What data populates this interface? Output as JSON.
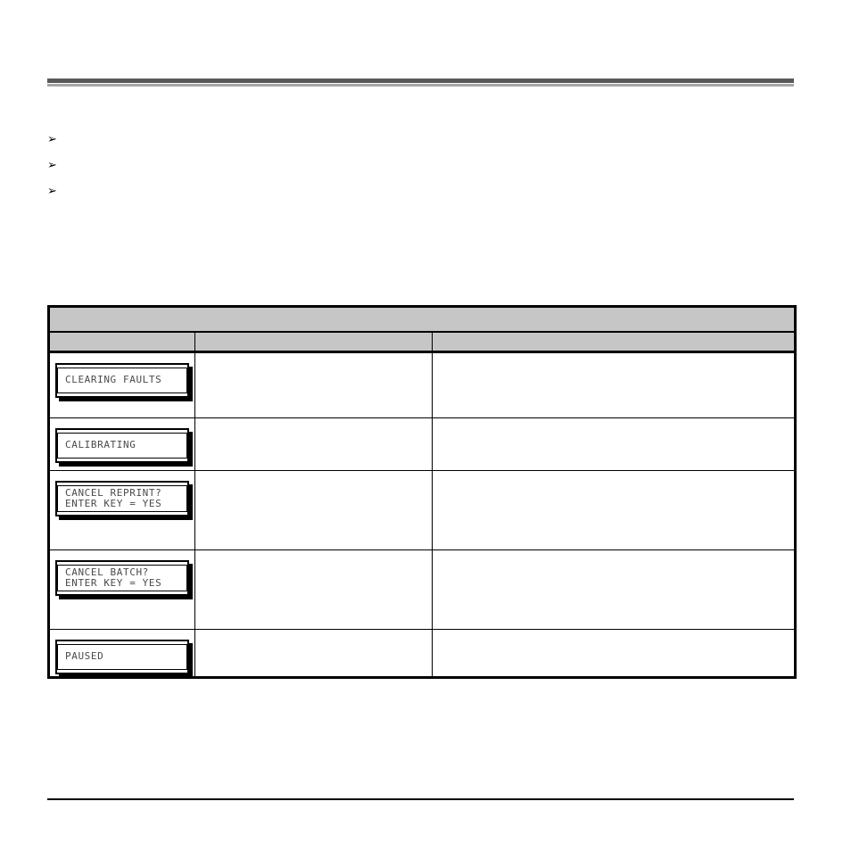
{
  "document": {
    "header_rule": {
      "dark_color": "#595959",
      "light_color": "#a6a6a6"
    },
    "footer_rule": {
      "color": "#000000"
    }
  },
  "bullets": {
    "marker": "➢",
    "items": [
      {
        "text": ""
      },
      {
        "text": ""
      },
      {
        "text": ""
      }
    ]
  },
  "table": {
    "title": "",
    "header_fill": "#c6c6c6",
    "columns": [
      {
        "label": ""
      },
      {
        "label": ""
      },
      {
        "label": ""
      }
    ],
    "rows": [
      {
        "display": {
          "lines": [
            "CLEARING FAULTS"
          ]
        },
        "col_b": "",
        "col_c": ""
      },
      {
        "display": {
          "lines": [
            "CALIBRATING"
          ]
        },
        "col_b": "",
        "col_c": ""
      },
      {
        "display": {
          "lines": [
            "CANCEL REPRINT?",
            "ENTER KEY = YES"
          ]
        },
        "col_b": "",
        "col_c": ""
      },
      {
        "display": {
          "lines": [
            "CANCEL BATCH?",
            "ENTER KEY = YES"
          ]
        },
        "col_b": "",
        "col_c": ""
      },
      {
        "display": {
          "lines": [
            "PAUSED"
          ]
        },
        "col_b": "",
        "col_c": ""
      }
    ]
  }
}
